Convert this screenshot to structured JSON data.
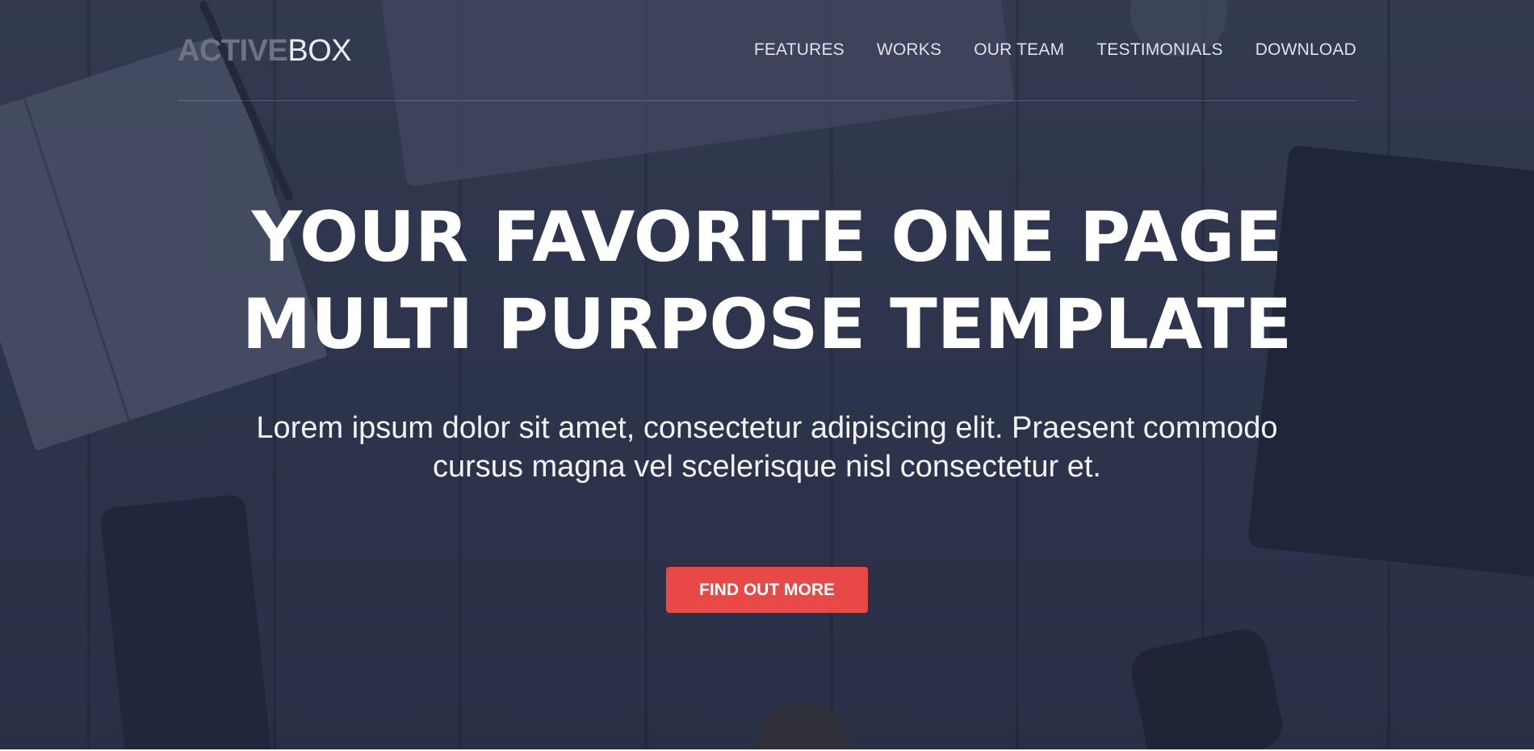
{
  "header": {
    "logo": {
      "strong": "ACTIVE",
      "light": "BOX"
    },
    "nav": [
      {
        "label": "FEATURES"
      },
      {
        "label": "WORKS"
      },
      {
        "label": "OUR TEAM"
      },
      {
        "label": "TESTIMONIALS"
      },
      {
        "label": "DOWNLOAD"
      }
    ]
  },
  "hero": {
    "headline": {
      "line1": "YOUR FAVORITE ONE PAGE",
      "line2": "MULTI PURPOSE TEMPLATE"
    },
    "subtext": {
      "line1": "Lorem ipsum dolor sit amet, consectetur adipiscing elit. Praesent commodo",
      "line2": "cursus magna vel scelerisque nisl consectetur et."
    },
    "cta_label": "FIND OUT MORE"
  },
  "colors": {
    "accent": "#e84846",
    "background": "#323a51",
    "text": "#ffffff"
  }
}
